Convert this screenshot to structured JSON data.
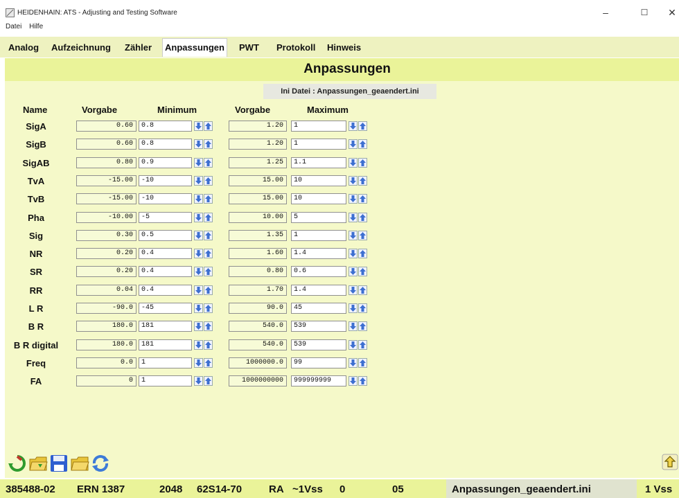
{
  "window": {
    "title": "HEIDENHAIN: ATS - Adjusting and Testing Software",
    "controls": [
      "–",
      "☐",
      "✕"
    ]
  },
  "menu": [
    "Datei",
    "Hilfe"
  ],
  "tabs": [
    "Analog",
    "Aufzeichnung",
    "Zähler",
    "Anpassungen",
    "PWT",
    "Protokoll",
    "Hinweis"
  ],
  "active_tab": "Anpassungen",
  "page": {
    "title": "Anpassungen",
    "ini_label": "Ini Datei : Anpassungen_geaendert.ini"
  },
  "columns": [
    "Name",
    "Vorgabe",
    "Minimum",
    "Vorgabe",
    "Maximum"
  ],
  "rows": [
    {
      "name": "SigA",
      "vorgabe_min": "0.60",
      "minimum": "0.8",
      "vorgabe_max": "1.20",
      "maximum": "1"
    },
    {
      "name": "SigB",
      "vorgabe_min": "0.60",
      "minimum": "0.8",
      "vorgabe_max": "1.20",
      "maximum": "1"
    },
    {
      "name": "SigAB",
      "vorgabe_min": "0.80",
      "minimum": "0.9",
      "vorgabe_max": "1.25",
      "maximum": "1.1"
    },
    {
      "name": "TvA",
      "vorgabe_min": "-15.00",
      "minimum": "-10",
      "vorgabe_max": "15.00",
      "maximum": "10"
    },
    {
      "name": "TvB",
      "vorgabe_min": "-15.00",
      "minimum": "-10",
      "vorgabe_max": "15.00",
      "maximum": "10"
    },
    {
      "name": "Pha",
      "vorgabe_min": "-10.00",
      "minimum": "-5",
      "vorgabe_max": "10.00",
      "maximum": "5"
    },
    {
      "name": "Sig",
      "vorgabe_min": "0.30",
      "minimum": "0.5",
      "vorgabe_max": "1.35",
      "maximum": "1"
    },
    {
      "name": "NR",
      "vorgabe_min": "0.20",
      "minimum": "0.4",
      "vorgabe_max": "1.60",
      "maximum": "1.4"
    },
    {
      "name": "SR",
      "vorgabe_min": "0.20",
      "minimum": "0.4",
      "vorgabe_max": "0.80",
      "maximum": "0.6"
    },
    {
      "name": "RR",
      "vorgabe_min": "0.04",
      "minimum": "0.4",
      "vorgabe_max": "1.70",
      "maximum": "1.4"
    },
    {
      "name": "L R",
      "vorgabe_min": "-90.0",
      "minimum": "-45",
      "vorgabe_max": "90.0",
      "maximum": "45"
    },
    {
      "name": "B R",
      "vorgabe_min": "180.0",
      "minimum": "181",
      "vorgabe_max": "540.0",
      "maximum": "539"
    },
    {
      "name": "B R digital",
      "vorgabe_min": "180.0",
      "minimum": "181",
      "vorgabe_max": "540.0",
      "maximum": "539"
    },
    {
      "name": "Freq",
      "vorgabe_min": "0.0",
      "minimum": "1",
      "vorgabe_max": "1000000.0",
      "maximum": "99"
    },
    {
      "name": "FA",
      "vorgabe_min": "0",
      "minimum": "1",
      "vorgabe_max": "1000000000",
      "maximum": "999999999"
    }
  ],
  "toolbar_icons": [
    "refresh-icon",
    "open-folder-icon",
    "save-icon",
    "folder-icon",
    "sync-icon",
    "upload-icon"
  ],
  "status": {
    "id": "385488-02",
    "model": "ERN 1387",
    "lines": "2048",
    "code": "62S14-70",
    "ra": "RA",
    "signal": "~1Vss",
    "zero": "0",
    "num": "05",
    "ini": "Anpassungen_geaendert.ini",
    "vss": "1 Vss"
  },
  "colors": {
    "header_band": "#eaf399",
    "content_bg": "#f5f9c9",
    "tab_bg": "#eef2c0",
    "arrow_blue": "#3d6fd0"
  }
}
